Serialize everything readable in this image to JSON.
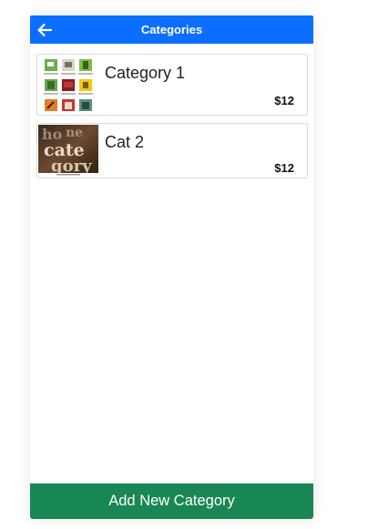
{
  "appbar": {
    "title": "Categories",
    "back_icon": "arrow-left-icon",
    "color": "#0c6efd"
  },
  "categories": [
    {
      "title": "Category 1",
      "price": "$12",
      "thumbnail_icon": "category-grid-thumbnail"
    },
    {
      "title": "Cat 2",
      "price": "$12",
      "thumbnail_icon": "category-letters-thumbnail"
    }
  ],
  "footer": {
    "add_label": "Add New Category",
    "color": "#198754"
  }
}
